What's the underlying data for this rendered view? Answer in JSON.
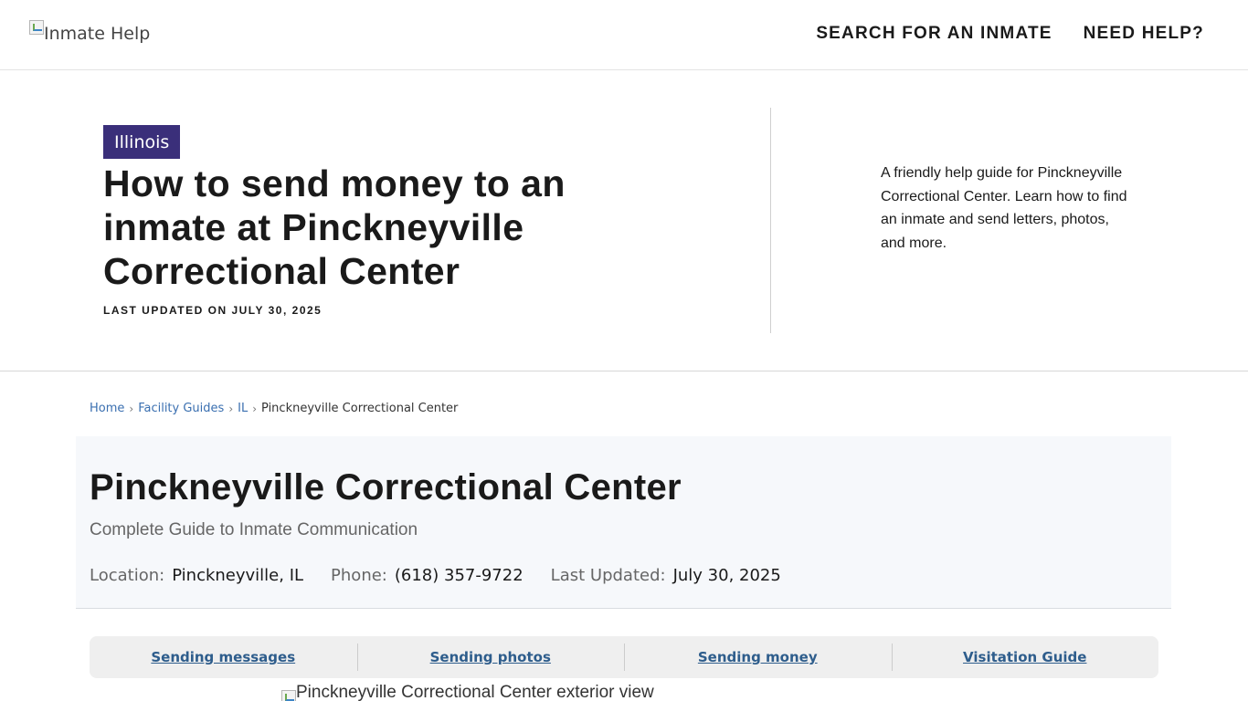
{
  "header": {
    "logo_alt": "Inmate Help",
    "nav": [
      {
        "label": "SEARCH FOR AN INMATE"
      },
      {
        "label": "NEED HELP?"
      }
    ]
  },
  "hero": {
    "badge": "Illinois",
    "title": "How to send money to an inmate at Pinckneyville Correctional Center",
    "updated": "LAST UPDATED ON JULY 30, 2025",
    "description": "A friendly help guide for Pinckneyville Correctional Center. Learn how to find an inmate and send letters, photos, and more."
  },
  "breadcrumb": {
    "items": [
      "Home",
      "Facility Guides",
      "IL"
    ],
    "current": "Pinckneyville Correctional Center",
    "separator": "›"
  },
  "facility": {
    "title": "Pinckneyville Correctional Center",
    "subtitle": "Complete Guide to Inmate Communication",
    "location_label": "Location:",
    "location_value": "Pinckneyville, IL",
    "phone_label": "Phone:",
    "phone_value": "(618) 357-9722",
    "updated_label": "Last Updated:",
    "updated_value": "July 30, 2025"
  },
  "tabs": [
    {
      "label": "Sending messages"
    },
    {
      "label": "Sending photos"
    },
    {
      "label": "Sending money"
    },
    {
      "label": "Visitation Guide"
    }
  ],
  "exterior_image_alt": "Pinckneyville Correctional Center exterior view"
}
